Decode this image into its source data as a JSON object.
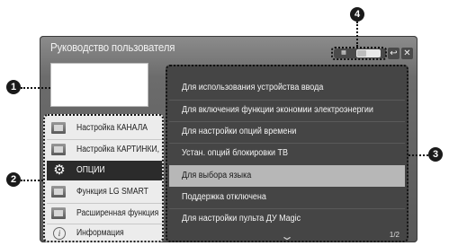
{
  "window": {
    "title": "Руководство пользователя",
    "controls": {
      "grid_icon": "grid-icon",
      "back_icon": "back-icon",
      "close_icon": "close-icon",
      "grid_glyph": "▦",
      "back_glyph": "↩",
      "close_glyph": "✕"
    }
  },
  "sidebar": {
    "items": [
      {
        "label": "Настройка КАНАЛА",
        "icon": "channel-icon"
      },
      {
        "label": "Настройка КАРТИНКИ, ЗВУКА",
        "icon": "picture-sound-icon"
      },
      {
        "label": "ОПЦИИ",
        "icon": "gear-icon",
        "active": true
      },
      {
        "label": "Функция LG SMART",
        "icon": "smart-icon"
      },
      {
        "label": "Расширенная функция",
        "icon": "advanced-icon"
      },
      {
        "label": "Информация",
        "icon": "info-icon"
      }
    ],
    "gear_glyph": "⚙",
    "info_glyph": "i"
  },
  "main_list": {
    "items": [
      {
        "label": "Для использования устройства ввода"
      },
      {
        "label": "Для включения функции экономии электроэнергии"
      },
      {
        "label": "Для настройки опций времени"
      },
      {
        "label": "Устан. опций блокировки ТВ"
      },
      {
        "label": "Для выбора языка",
        "highlight": true
      },
      {
        "label": "Поддержка отключена"
      },
      {
        "label": "Для настройки пульта ДУ Magic"
      }
    ],
    "page_indicator": "1/2",
    "scroll_glyph": "⌄"
  },
  "callouts": [
    "1",
    "2",
    "3",
    "4"
  ]
}
